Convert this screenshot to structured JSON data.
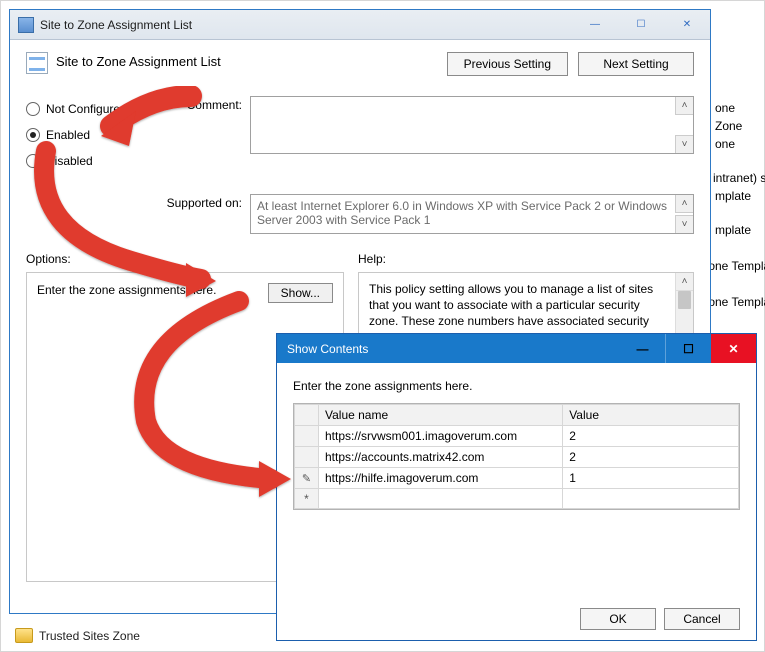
{
  "main": {
    "title": "Site to Zone Assignment List",
    "header_title": "Site to Zone Assignment List",
    "prev_btn": "Previous Setting",
    "next_btn": "Next Setting",
    "comment_label": "Comment:",
    "supported_label": "Supported on:",
    "supported_text": "At least Internet Explorer 6.0 in Windows XP with Service Pack 2 or Windows Server 2003 with Service Pack 1",
    "radios": {
      "not_configured": "Not Configured",
      "enabled": "Enabled",
      "disabled": "Disabled",
      "selected": "enabled"
    },
    "options_label": "Options:",
    "help_label": "Help:",
    "options_panel": {
      "text": "Enter the zone assignments here.",
      "show_btn": "Show..."
    },
    "help_text": "This policy setting allows you to manage a list of sites that you want to associate with a particular security zone. These zone numbers have associated security settings that apply to all of the sites in the zone."
  },
  "modal": {
    "title": "Show Contents",
    "label": "Enter the zone assignments here.",
    "col_name": "Value name",
    "col_value": "Value",
    "rows": [
      {
        "name": "https://srvwsm001.imagoverum.com",
        "value": "2"
      },
      {
        "name": "https://accounts.matrix42.com",
        "value": "2"
      },
      {
        "name": "https://hilfe.imagoverum.com",
        "value": "1"
      }
    ],
    "ok": "OK",
    "cancel": "Cancel"
  },
  "background": {
    "items": [
      "one",
      "Zone",
      "one",
      "intranet) site",
      "mplate",
      "mplate",
      "Zone Templat",
      "Zone Templat"
    ]
  },
  "footer_tree": "Trusted Sites Zone",
  "glyphs": {
    "min": "—",
    "max": "☐",
    "close": "✕",
    "up": "˄ ",
    "down": "˅"
  }
}
